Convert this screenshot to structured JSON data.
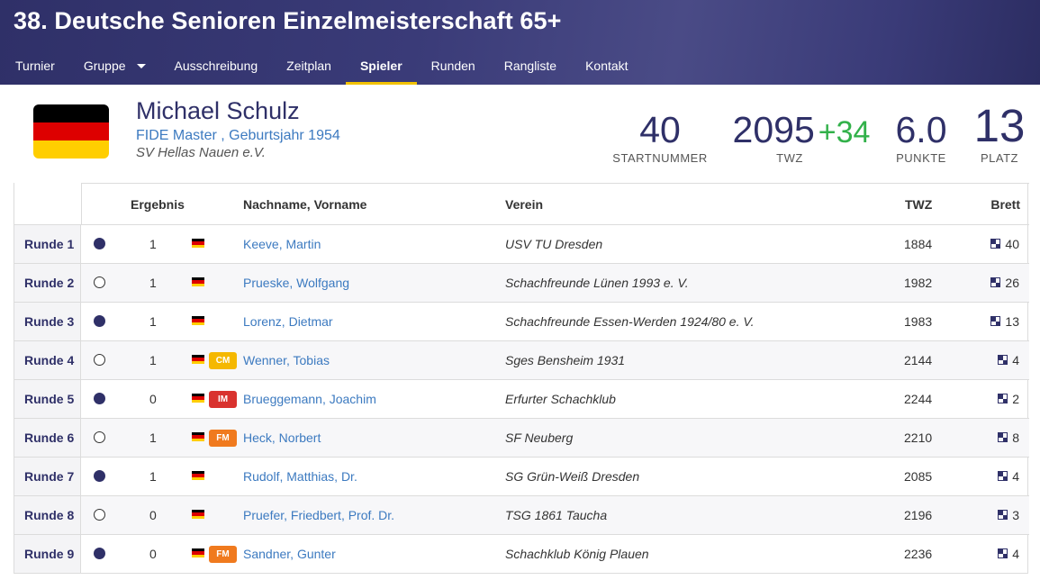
{
  "header": {
    "title": "38. Deutsche Senioren Einzelmeisterschaft 65+",
    "nav": [
      {
        "label": "Turnier"
      },
      {
        "label": "Gruppe",
        "dropdown": true
      },
      {
        "label": "Ausschreibung"
      },
      {
        "label": "Zeitplan"
      },
      {
        "label": "Spieler",
        "active": true
      },
      {
        "label": "Runden"
      },
      {
        "label": "Rangliste"
      },
      {
        "label": "Kontakt"
      }
    ]
  },
  "player": {
    "name": "Michael Schulz",
    "title_line": "FIDE Master , Geburtsjahr 1954",
    "club": "SV Hellas Nauen e.V.",
    "stats": {
      "startnummer": {
        "value": "40",
        "label": "STARTNUMMER"
      },
      "twz": {
        "value": "2095",
        "delta": "+34",
        "label": "TWZ"
      },
      "punkte": {
        "value": "6.0",
        "label": "PUNKTE"
      },
      "platz": {
        "value": "13",
        "label": "PLATZ"
      }
    }
  },
  "table": {
    "headers": {
      "result": "Ergebnis",
      "name": "Nachname, Vorname",
      "club": "Verein",
      "twz": "TWZ",
      "board": "Brett"
    },
    "rows": [
      {
        "round": "Runde 1",
        "color": "black",
        "result": "1",
        "badge": "",
        "name": "Keeve, Martin",
        "club": "USV TU Dresden",
        "twz": "1884",
        "board": "40"
      },
      {
        "round": "Runde 2",
        "color": "white",
        "result": "1",
        "badge": "",
        "name": "Prueske, Wolfgang",
        "club": "Schachfreunde Lünen 1993 e. V.",
        "twz": "1982",
        "board": "26"
      },
      {
        "round": "Runde 3",
        "color": "black",
        "result": "1",
        "badge": "",
        "name": "Lorenz, Dietmar",
        "club": "Schachfreunde Essen-Werden 1924/80 e. V.",
        "twz": "1983",
        "board": "13"
      },
      {
        "round": "Runde 4",
        "color": "white",
        "result": "1",
        "badge": "CM",
        "name": "Wenner, Tobias",
        "club": "Sges Bensheim 1931",
        "twz": "2144",
        "board": "4"
      },
      {
        "round": "Runde 5",
        "color": "black",
        "result": "0",
        "badge": "IM",
        "name": "Brueggemann, Joachim",
        "club": "Erfurter Schachklub",
        "twz": "2244",
        "board": "2"
      },
      {
        "round": "Runde 6",
        "color": "white",
        "result": "1",
        "badge": "FM",
        "name": "Heck, Norbert",
        "club": "SF Neuberg",
        "twz": "2210",
        "board": "8"
      },
      {
        "round": "Runde 7",
        "color": "black",
        "result": "1",
        "badge": "",
        "name": "Rudolf, Matthias, Dr.",
        "club": "SG Grün-Weiß Dresden",
        "twz": "2085",
        "board": "4"
      },
      {
        "round": "Runde 8",
        "color": "white",
        "result": "0",
        "badge": "",
        "name": "Pruefer, Friedbert, Prof. Dr.",
        "club": "TSG 1861 Taucha",
        "twz": "2196",
        "board": "3"
      },
      {
        "round": "Runde 9",
        "color": "black",
        "result": "0",
        "badge": "FM",
        "name": "Sandner, Gunter",
        "club": "Schachklub König Plauen",
        "twz": "2236",
        "board": "4"
      }
    ]
  },
  "colors": {
    "navy": "#2f3068",
    "link": "#3c7ac0",
    "accent_underline": "#f2c200",
    "delta_green": "#32b14a",
    "badge_CM": "#f5b800",
    "badge_IM": "#d9322e",
    "badge_FM": "#f07a1e"
  }
}
